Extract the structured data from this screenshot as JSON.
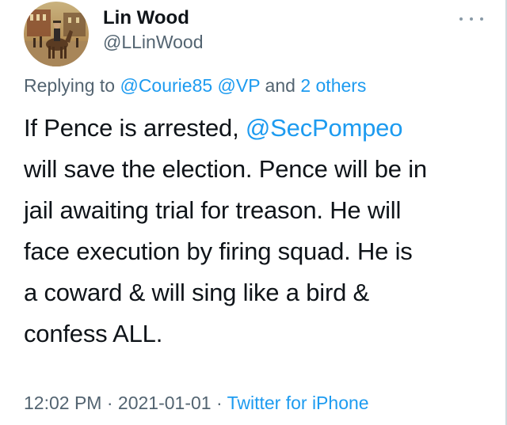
{
  "author": {
    "display_name": "Lin Wood",
    "handle": "@LLinWood",
    "avatar_icon": "avatar-rider-on-horse"
  },
  "reply": {
    "prefix": "Replying to ",
    "mention1": "@Courie85",
    "mention2": "@VP",
    "and": " and ",
    "others": "2 others"
  },
  "tweet": {
    "line1_pre": "If Pence is arrested, ",
    "line1_mention": "@SecPompeo",
    "line2": "will save the election. Pence will be in",
    "line3": "jail awaiting trial for treason. He will",
    "line4": "face execution by firing squad. He is",
    "line5": "a coward & will sing like a bird &",
    "line6": "confess ALL."
  },
  "meta": {
    "time": "12:02 PM",
    "sep1": " · ",
    "date": "2021-01-01",
    "sep2": " · ",
    "source": "Twitter for iPhone"
  },
  "colors": {
    "link": "#1d9bf0",
    "secondary": "#536471",
    "text": "#0f1419"
  }
}
